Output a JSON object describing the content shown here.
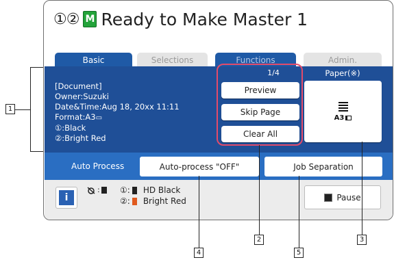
{
  "title": {
    "drum_numbers": "①②",
    "master_icon_letter": "M",
    "text": "Ready to Make Master 1"
  },
  "tabs": [
    {
      "label": "Basic"
    },
    {
      "label": "Selections"
    },
    {
      "label": "Functions"
    },
    {
      "label": "Admin."
    }
  ],
  "document": {
    "heading": "[Document]",
    "owner": "Owner:Suzuki",
    "datetime": "Date&Time:Aug 18, 20xx 11:11",
    "format": "Format:A3",
    "drum1": "①:Black",
    "drum2": "②:Bright Red"
  },
  "page_counter": "1/4",
  "buttons": {
    "preview": "Preview",
    "skip_page": "Skip Page",
    "clear_all": "Clear All"
  },
  "paper": {
    "label": "Paper(※)",
    "size": "A3"
  },
  "auto_process": {
    "label": "Auto Process",
    "button": "Auto-process \"OFF\""
  },
  "job_separation": "Job Separation",
  "info_button": "i",
  "status": {
    "drum1_num": "①:",
    "drum1_name": "HD Black",
    "drum1_color": "#222222",
    "drum2_num": "②:",
    "drum2_name": "Bright Red",
    "drum2_color": "#e05a1e"
  },
  "pause_button": "Pause",
  "callouts": {
    "c1": "1",
    "c2": "2",
    "c3": "3",
    "c4": "4",
    "c5": "5"
  },
  "colors": {
    "tab_blue": "#1f5aa6",
    "panel_blue": "#1f4f97",
    "auto_row_blue": "#2a6ec2",
    "highlight_red": "#e34b6a"
  }
}
